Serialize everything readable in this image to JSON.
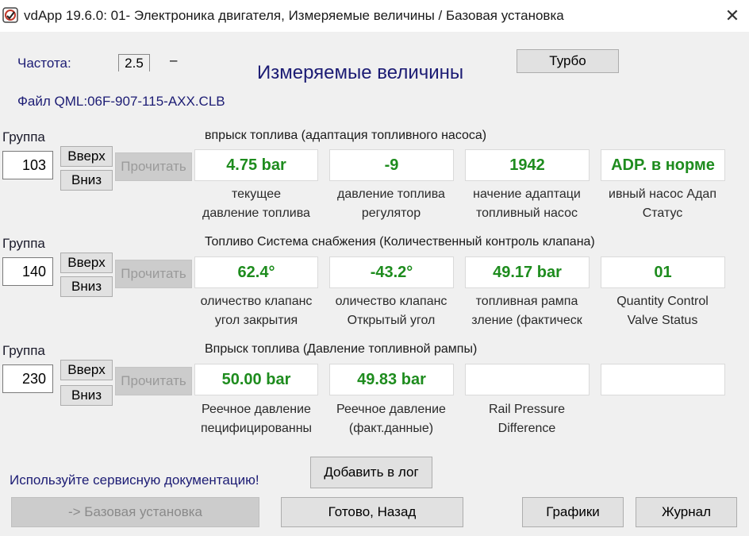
{
  "window": {
    "title": "vdApp 19.6.0: 01- Электроника двигателя,  Измеряемые величины / Базовая установка",
    "close_glyph": "✕"
  },
  "header": {
    "freq_label": "Частота:",
    "freq_value": "2.5",
    "freq_dash": "–",
    "page_title": "Измеряемые величины",
    "turbo_label": "Турбо",
    "file_label": "Файл QML:06F-907-115-AXX.CLB"
  },
  "groups": [
    {
      "label": "Группа",
      "number": "103",
      "up": "Вверх",
      "down": "Вниз",
      "read": "Прочитать",
      "title": "впрыск топлива (адаптация топливного насоса)",
      "values": [
        "4.75 bar",
        "-9",
        "1942",
        "ADP. в норме"
      ],
      "captions": [
        [
          "текущее",
          "давление топлива"
        ],
        [
          "давление топлива",
          "регулятор"
        ],
        [
          "начение адаптаци",
          "топливный насос"
        ],
        [
          "ивный насос Адап",
          "Статус"
        ]
      ]
    },
    {
      "label": "Группа",
      "number": "140",
      "up": "Вверх",
      "down": "Вниз",
      "read": "Прочитать",
      "title": "Топливо Система снабжения (Количественный контроль клапана)",
      "values": [
        "62.4°",
        "-43.2°",
        "49.17 bar",
        "01"
      ],
      "captions": [
        [
          "оличество клапанс",
          "угол закрытия"
        ],
        [
          "оличество клапанс",
          "Открытый угол"
        ],
        [
          "топливная рампа",
          "зление (фактическ"
        ],
        [
          "Quantity Control",
          "Valve Status"
        ]
      ]
    },
    {
      "label": "Группа",
      "number": "230",
      "up": "Вверх",
      "down": "Вниз",
      "read": "Прочитать",
      "title": "Впрыск топлива (Давление топливной рампы)",
      "values": [
        "50.00 bar",
        "49.83 bar",
        "",
        ""
      ],
      "captions": [
        [
          "Реечное давление",
          "пецифицированны"
        ],
        [
          "Реечное давление",
          "(факт.данные)"
        ],
        [
          "Rail Pressure",
          "Difference"
        ],
        [
          "",
          ""
        ]
      ]
    }
  ],
  "footer": {
    "hint": "Используйте сервисную документацию!",
    "add_log": "Добавить в лог",
    "basic_setting": "-> Базовая установка",
    "done_back": "Готово, Назад",
    "graphs": "Графики",
    "journal": "Журнал"
  },
  "colors": {
    "value_green": "#1e8c1e",
    "navy": "#1c1c74",
    "background": "#f0f0f0"
  }
}
